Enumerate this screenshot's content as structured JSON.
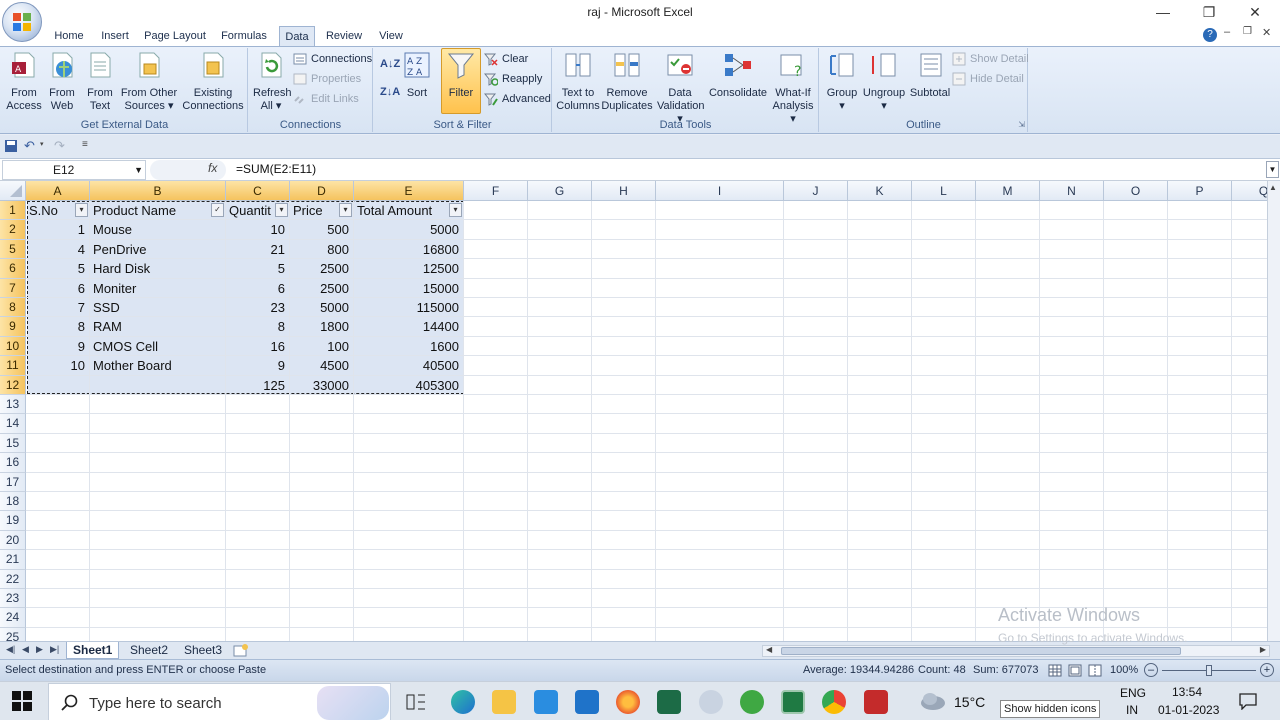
{
  "window": {
    "title": "raj - Microsoft Excel"
  },
  "tabs": [
    "Home",
    "Insert",
    "Page Layout",
    "Formulas",
    "Data",
    "Review",
    "View"
  ],
  "ribbon": {
    "get_external_data": {
      "label": "Get External Data",
      "buttons": [
        [
          "From",
          "Access"
        ],
        [
          "From",
          "Web"
        ],
        [
          "From",
          "Text"
        ],
        [
          "From Other",
          "Sources"
        ],
        [
          "Existing",
          "Connections"
        ]
      ]
    },
    "connections": {
      "label": "Connections",
      "refresh": [
        "Refresh",
        "All"
      ],
      "connections": "Connections",
      "properties": "Properties",
      "edit_links": "Edit Links"
    },
    "sort_filter": {
      "label": "Sort & Filter",
      "sort": "Sort",
      "filter": "Filter",
      "clear": "Clear",
      "reapply": "Reapply",
      "advanced": "Advanced"
    },
    "data_tools": {
      "label": "Data Tools",
      "buttons": [
        [
          "Text to",
          "Columns"
        ],
        [
          "Remove",
          "Duplicates"
        ],
        [
          "Data",
          "Validation"
        ],
        [
          "",
          "Consolidate"
        ],
        [
          "What-If",
          "Analysis"
        ]
      ]
    },
    "outline": {
      "label": "Outline",
      "group": "Group",
      "ungroup": "Ungroup",
      "subtotal": "Subtotal",
      "show_detail": "Show Detail",
      "hide_detail": "Hide Detail"
    }
  },
  "formula_bar": {
    "name_box": "E12",
    "fx": "fx",
    "formula": "=SUM(E2:E11)"
  },
  "grid": {
    "columns": [
      "A",
      "B",
      "C",
      "D",
      "E",
      "F",
      "G",
      "H",
      "I",
      "J",
      "K",
      "L",
      "M",
      "N",
      "O",
      "P",
      "Q"
    ],
    "row_numbers": [
      "1",
      "2",
      "5",
      "6",
      "7",
      "8",
      "9",
      "10",
      "11",
      "12",
      "13",
      "14",
      "15",
      "16",
      "17",
      "18",
      "19",
      "20",
      "21",
      "22",
      "23",
      "24",
      "25"
    ],
    "headers": [
      "S.No",
      "Product Name",
      "Quantit",
      "Price",
      "Total Amount"
    ],
    "rows": [
      [
        "1",
        "Mouse",
        "10",
        "500",
        "5000"
      ],
      [
        "4",
        "PenDrive",
        "21",
        "800",
        "16800"
      ],
      [
        "5",
        "Hard Disk",
        "5",
        "2500",
        "12500"
      ],
      [
        "6",
        "Moniter",
        "6",
        "2500",
        "15000"
      ],
      [
        "7",
        "SSD",
        "23",
        "5000",
        "115000"
      ],
      [
        "8",
        "RAM",
        "8",
        "1800",
        "14400"
      ],
      [
        "9",
        "CMOS Cell",
        "16",
        "100",
        "1600"
      ],
      [
        "10",
        "Mother Board",
        "9",
        "4500",
        "40500"
      ],
      [
        "",
        "",
        "125",
        "33000",
        "405300"
      ]
    ]
  },
  "sheets": [
    "Sheet1",
    "Sheet2",
    "Sheet3"
  ],
  "status": {
    "message": "Select destination and press ENTER or choose Paste",
    "average": "Average: 19344.94286",
    "count": "Count: 48",
    "sum": "Sum: 677073",
    "zoom": "100%"
  },
  "watermark": {
    "line1": "Activate Windows",
    "line2": "Go to Settings to activate Windows."
  },
  "taskbar": {
    "search_placeholder": "Type here to search",
    "weather": "15°C",
    "lang1": "ENG",
    "lang2": "IN",
    "time": "13:54",
    "date": "01-01-2023",
    "tooltip": "Show hidden icons"
  },
  "colors": {
    "accent": "#1f6f3a",
    "ribbon": "#dfe8f5",
    "selection": "#dce5f3",
    "filter_highlight": "#ffc24d"
  }
}
